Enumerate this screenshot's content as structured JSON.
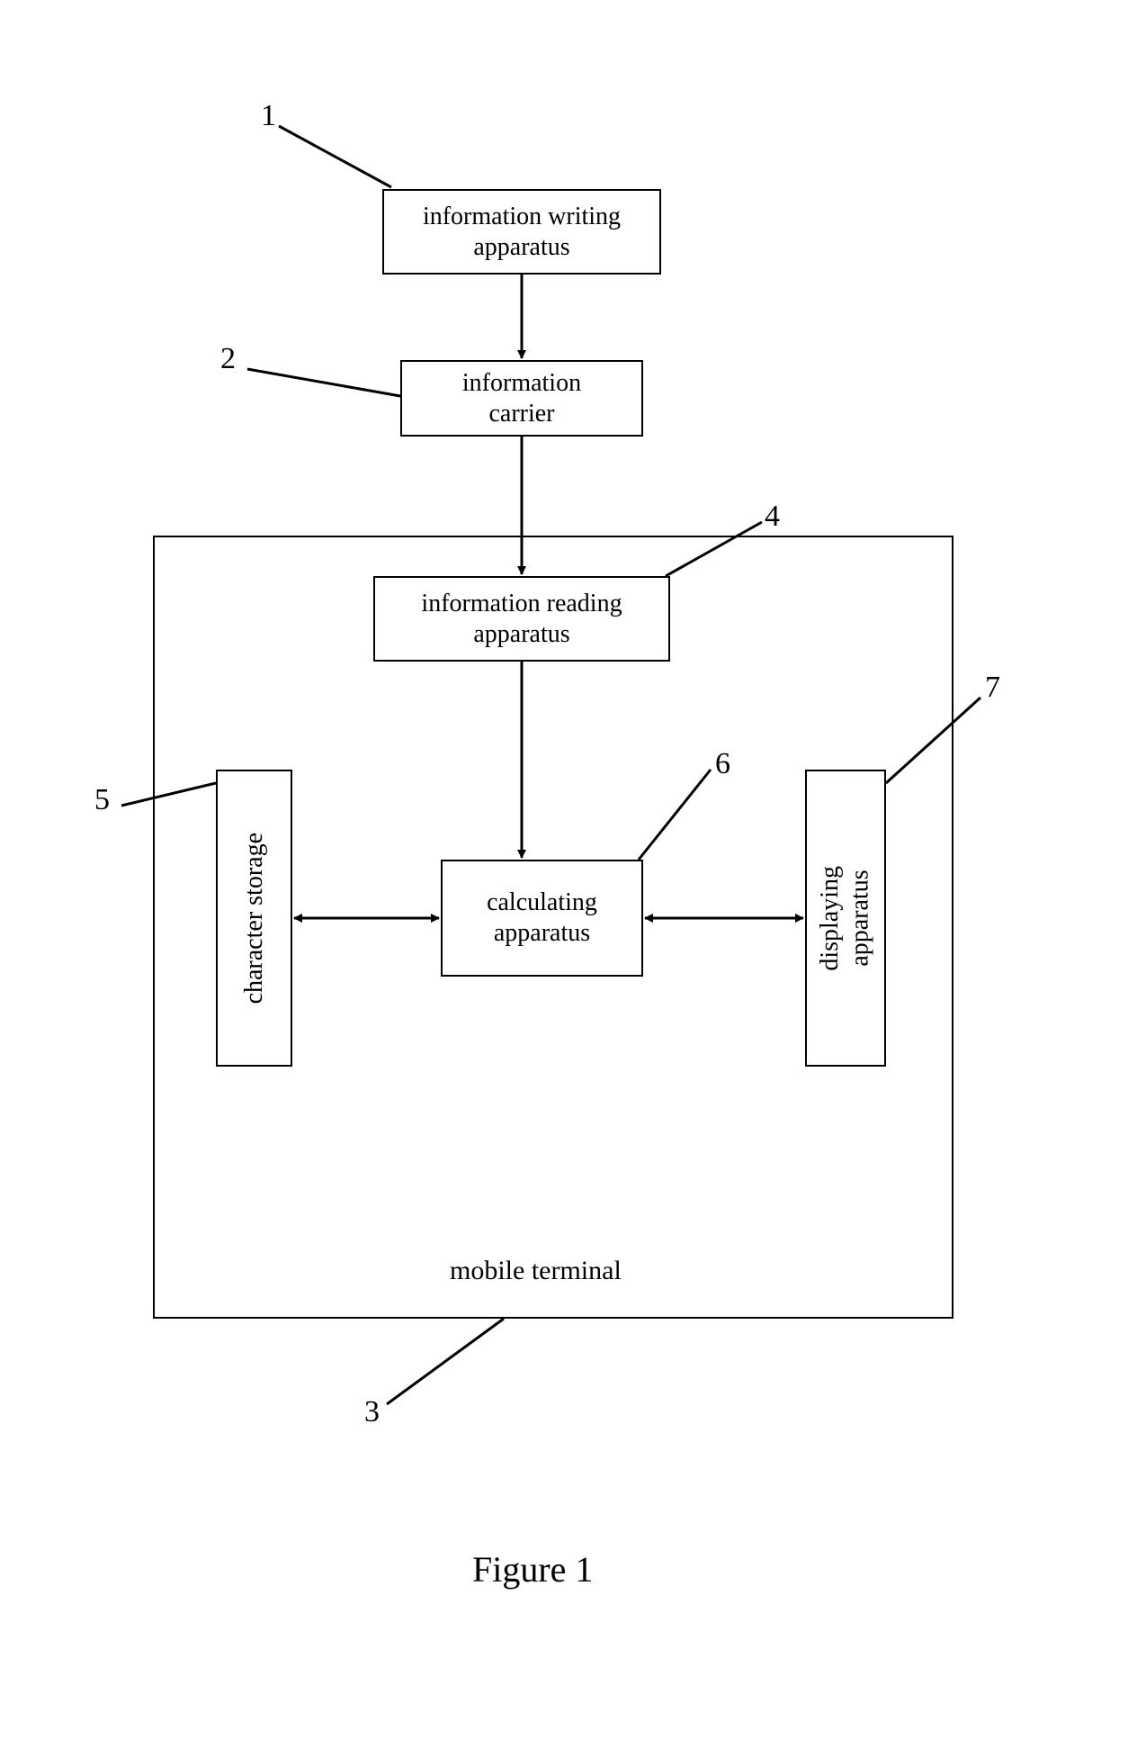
{
  "nodes": {
    "n1": {
      "id": "1",
      "label": "information writing\napparatus"
    },
    "n2": {
      "id": "2",
      "label": "information\ncarrier"
    },
    "n3": {
      "id": "3",
      "label": "mobile terminal"
    },
    "n4": {
      "id": "4",
      "label": "information reading\napparatus"
    },
    "n5": {
      "id": "5",
      "label": "character storage"
    },
    "n6": {
      "id": "6",
      "label": "calculating\napparatus"
    },
    "n7": {
      "id": "7",
      "label": "displaying\napparatus"
    }
  },
  "caption": "Figure 1"
}
